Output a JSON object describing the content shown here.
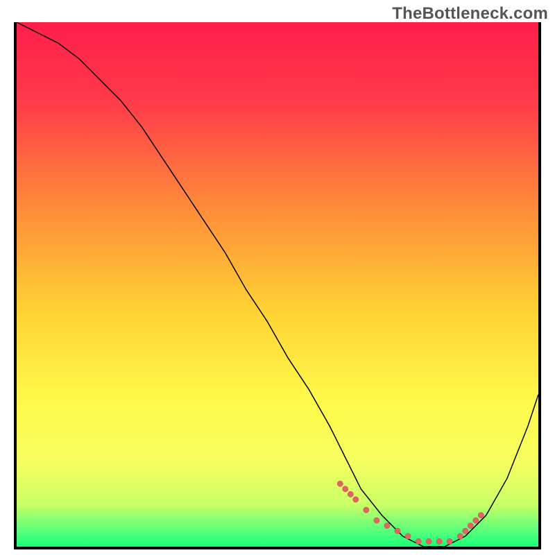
{
  "watermark": "TheBottleneck.com",
  "colors": {
    "gradient_stops": [
      {
        "offset": 0.0,
        "color": "#FF1E4A"
      },
      {
        "offset": 0.15,
        "color": "#FF3A4A"
      },
      {
        "offset": 0.35,
        "color": "#FF8A3A"
      },
      {
        "offset": 0.55,
        "color": "#FFD233"
      },
      {
        "offset": 0.72,
        "color": "#FFF94A"
      },
      {
        "offset": 0.84,
        "color": "#F6FF60"
      },
      {
        "offset": 0.92,
        "color": "#C9FF66"
      },
      {
        "offset": 0.97,
        "color": "#58FF7A"
      },
      {
        "offset": 1.0,
        "color": "#18FF7A"
      }
    ],
    "curve": "#000000",
    "dot_fill": "#E06666",
    "dot_stroke": "#C44D4D"
  },
  "chart_data": {
    "type": "line",
    "title": "",
    "xlabel": "",
    "ylabel": "",
    "xlim": [
      0,
      100
    ],
    "ylim": [
      0,
      100
    ],
    "series": [
      {
        "name": "curve",
        "x": [
          0,
          4,
          8,
          12,
          16,
          20,
          24,
          28,
          32,
          36,
          40,
          44,
          48,
          52,
          56,
          60,
          63,
          66,
          70,
          74,
          78,
          82,
          86,
          90,
          94,
          98,
          100
        ],
        "y": [
          100,
          98,
          96,
          93,
          89,
          85,
          80,
          74,
          68,
          62,
          56,
          49,
          43,
          36,
          30,
          23,
          17,
          11,
          6,
          2,
          0,
          0,
          2,
          6,
          13,
          23,
          29
        ]
      }
    ],
    "markers": {
      "name": "bottleneck-zone",
      "points": [
        {
          "x": 62,
          "y": 12
        },
        {
          "x": 63,
          "y": 11
        },
        {
          "x": 64,
          "y": 10
        },
        {
          "x": 65,
          "y": 9
        },
        {
          "x": 67,
          "y": 7
        },
        {
          "x": 69,
          "y": 5
        },
        {
          "x": 71,
          "y": 4
        },
        {
          "x": 73,
          "y": 3
        },
        {
          "x": 75,
          "y": 2
        },
        {
          "x": 77,
          "y": 1
        },
        {
          "x": 79,
          "y": 1
        },
        {
          "x": 81,
          "y": 1
        },
        {
          "x": 83,
          "y": 1
        },
        {
          "x": 85,
          "y": 2
        },
        {
          "x": 86,
          "y": 3
        },
        {
          "x": 87,
          "y": 4
        },
        {
          "x": 88,
          "y": 5
        },
        {
          "x": 89,
          "y": 6
        }
      ]
    }
  }
}
